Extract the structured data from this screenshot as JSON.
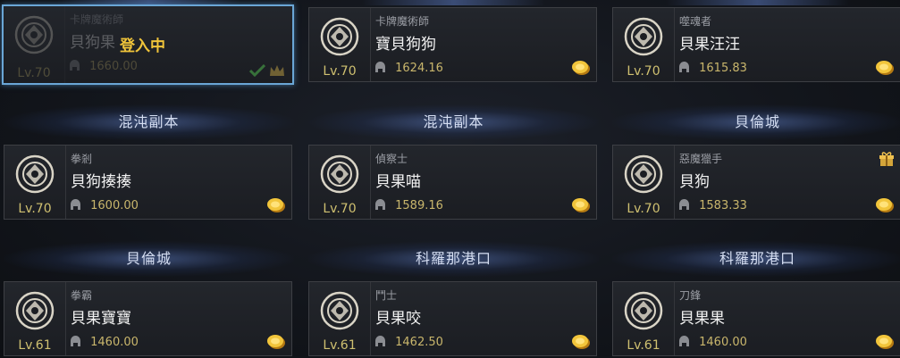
{
  "columns": [
    {
      "slots": [
        {
          "header": "",
          "level": "Lv.70",
          "class": "卡牌魔術師",
          "name": "貝狗果",
          "item_level": "1660.00",
          "icon": "arcanist-emblem-icon",
          "status": "登入中",
          "active": true
        },
        {
          "header": "混沌副本",
          "level": "Lv.70",
          "class": "拳剎",
          "name": "貝狗揍揍",
          "item_level": "1600.00",
          "icon": "wardancer-fist-icon"
        },
        {
          "header": "貝倫城",
          "level": "Lv.61",
          "class": "拳霸",
          "name": "貝果寶寶",
          "item_level": "1460.00",
          "icon": "scrapper-dragon-icon"
        }
      ]
    },
    {
      "slots": [
        {
          "header": "",
          "level": "Lv.70",
          "class": "卡牌魔術師",
          "name": "寶貝狗狗",
          "item_level": "1624.16",
          "icon": "arcanist-emblem-icon"
        },
        {
          "header": "混沌副本",
          "level": "Lv.70",
          "class": "偵察士",
          "name": "貝果喵",
          "item_level": "1589.16",
          "icon": "machinist-gear-icon"
        },
        {
          "header": "科羅那港口",
          "level": "Lv.61",
          "class": "鬥士",
          "name": "貝果咬",
          "item_level": "1462.50",
          "icon": "gladiator-tiger-icon"
        }
      ]
    },
    {
      "slots": [
        {
          "header": "",
          "level": "Lv.70",
          "class": "噬魂者",
          "name": "貝果汪汪",
          "item_level": "1615.83",
          "icon": "reaper-scythe-icon"
        },
        {
          "header": "貝倫城",
          "level": "Lv.70",
          "class": "惡魔獵手",
          "name": "貝狗",
          "item_level": "1583.33",
          "icon": "deadeye-cross-icon"
        },
        {
          "header": "科羅那港口",
          "level": "Lv.61",
          "class": "刀鋒",
          "name": "貝果果",
          "item_level": "1460.00",
          "icon": "blade-crossed-icon"
        }
      ]
    }
  ],
  "colors": {
    "level": "#cfc070",
    "item_level": "#c9b66c",
    "status": "#f0c43a",
    "active_border": "#6aa6d6"
  }
}
